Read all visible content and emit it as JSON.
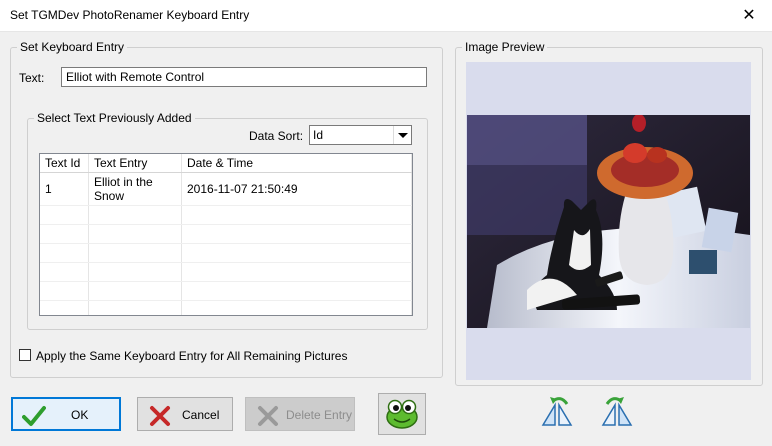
{
  "window": {
    "title": "Set TGMDev PhotoRenamer Keyboard Entry",
    "close_glyph": "✕"
  },
  "entry_group": {
    "legend": "Set Keyboard Entry",
    "text_label": "Text:",
    "text_value": "Elliot with Remote Control"
  },
  "previous_group": {
    "legend": "Select Text Previously Added",
    "sort_label": "Data Sort:",
    "sort_value": "Id",
    "columns": [
      "Text Id",
      "Text Entry",
      "Date & Time"
    ],
    "rows": [
      {
        "id": "1",
        "entry": "Elliot in the Snow",
        "date": "2016-11-07 21:50:49"
      }
    ]
  },
  "apply_all": {
    "label": "Apply the Same Keyboard Entry for All Remaining Pictures",
    "checked": false
  },
  "buttons": {
    "ok": "OK",
    "cancel": "Cancel",
    "delete": "Delete Entry"
  },
  "preview": {
    "legend": "Image Preview"
  },
  "icons": {
    "ok": "checkmark-icon",
    "cancel": "x-icon",
    "delete": "x-disabled-icon",
    "mascot": "frog-mascot-icon",
    "rotate_left": "rotate-left-icon",
    "rotate_right": "rotate-right-icon"
  },
  "colors": {
    "accent": "#0078d7",
    "preview_bg": "#d9dced"
  }
}
